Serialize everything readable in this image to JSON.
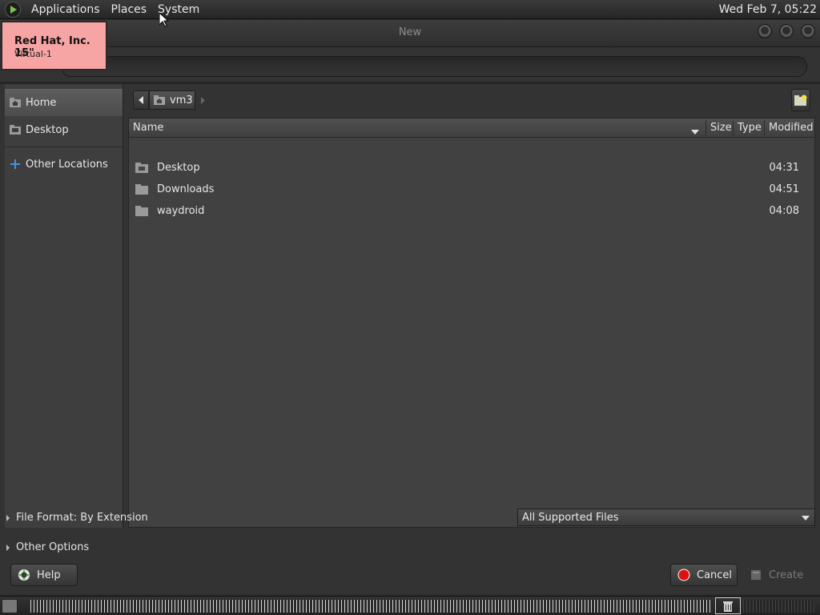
{
  "top_panel": {
    "menus": [
      "Applications",
      "Places",
      "System"
    ],
    "clock": "Wed Feb  7, 05:22"
  },
  "window": {
    "title": "New"
  },
  "monitor_label": {
    "name": "Red Hat, Inc. 15\"",
    "connector": "Virtual-1"
  },
  "sidebar": {
    "items": [
      {
        "label": "Home",
        "icon": "home-folder-icon",
        "active": true
      },
      {
        "label": "Desktop",
        "icon": "desktop-folder-icon",
        "active": false
      },
      {
        "label": "Other Locations",
        "icon": "plus-icon",
        "active": false
      }
    ]
  },
  "path_bar": {
    "current": "vm3"
  },
  "file_list": {
    "columns": [
      "Name",
      "Size",
      "Type",
      "Modified"
    ],
    "rows": [
      {
        "name": "Desktop",
        "size": "",
        "type": "",
        "modified": "04:31",
        "icon": "desktop-folder-icon"
      },
      {
        "name": "Downloads",
        "size": "",
        "type": "",
        "modified": "04:51",
        "icon": "folder-icon"
      },
      {
        "name": "waydroid",
        "size": "",
        "type": "",
        "modified": "04:08",
        "icon": "folder-icon"
      }
    ]
  },
  "options": {
    "file_format": "File Format: By Extension",
    "other_options": "Other Options",
    "filter": "All Supported Files"
  },
  "buttons": {
    "help": "Help",
    "cancel": "Cancel",
    "create": "Create"
  },
  "colors": {
    "cancel_icon": "#e01010",
    "monitor_label_bg": "#f6a4a4",
    "active_sidebar": "#5a5a5a"
  }
}
